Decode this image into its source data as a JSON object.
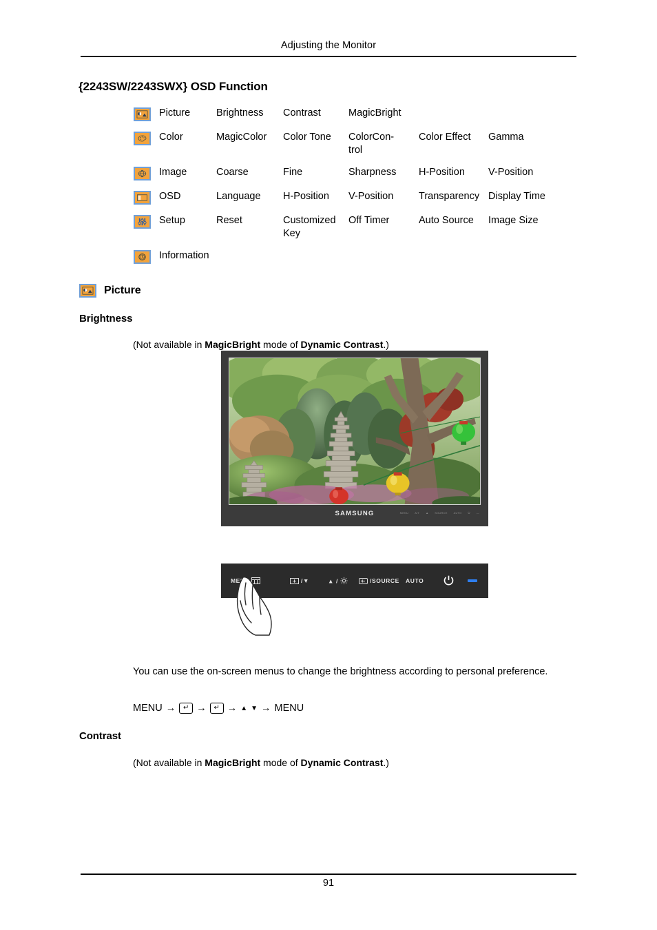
{
  "header": {
    "running_title": "Adjusting the Monitor"
  },
  "section": {
    "title": "{2243SW/2243SWX} OSD Function"
  },
  "osd_table": {
    "rows": [
      {
        "icon": "picture-icon",
        "category": "Picture",
        "items": [
          "Brightness",
          "Contrast",
          "MagicBright",
          "",
          ""
        ]
      },
      {
        "icon": "color-palette-icon",
        "category": "Color",
        "items": [
          "MagicColor",
          "Color Tone",
          "Color Con-trol",
          "Color Effect",
          "Gamma"
        ]
      },
      {
        "icon": "image-icon",
        "category": "Image",
        "items": [
          "Coarse",
          "Fine",
          "Sharpness",
          "H-Position",
          "V-Position"
        ]
      },
      {
        "icon": "osd-icon",
        "category": "OSD",
        "items": [
          "Language",
          "H-Position",
          "V-Position",
          "Transparency",
          "Display Time"
        ]
      },
      {
        "icon": "setup-sliders-icon",
        "category": "Setup",
        "items": [
          "Reset",
          "Customized Key",
          "Off Timer",
          "Auto Source",
          "Image Size"
        ]
      },
      {
        "icon": "information-clock-icon",
        "category": "Information",
        "items": [
          "",
          "",
          "",
          "",
          ""
        ]
      }
    ],
    "color_control_part1": "Color",
    "color_control_part2": "Con-",
    "color_control_part3": "trol"
  },
  "picture_section": {
    "heading": "Picture",
    "brightness": {
      "heading": "Brightness",
      "note_prefix": "(Not available in ",
      "note_bold1": "MagicBright",
      "note_middle": " mode of ",
      "note_bold2": "Dynamic Contrast",
      "note_suffix": ".)",
      "body": "You can use the on-screen menus to change the brightness according to personal preference.",
      "nav_start": "MENU",
      "nav_enter": "↵",
      "nav_arrow_up": "▲",
      "nav_arrow_down": "▼",
      "nav_end": "MENU",
      "nav_separator": "→"
    },
    "contrast": {
      "heading": "Contrast",
      "note_prefix": "(Not available in ",
      "note_bold1": "MagicBright",
      "note_middle": " mode of ",
      "note_bold2": "Dynamic Contrast",
      "note_suffix": ".)"
    }
  },
  "monitor_figure": {
    "brand": "SAMSUNG",
    "bezel_keys": [
      "MENU",
      "A/T",
      "▲",
      "SOURCE",
      "AUTO",
      "⏻",
      "—"
    ]
  },
  "control_panel": {
    "menu_label": "MENU",
    "down_label": "/▼",
    "up_label": "/",
    "source_label": "/SOURCE",
    "auto_label": "AUTO",
    "power_label": "power-button",
    "led_label": "power-led"
  },
  "footer": {
    "page_number": "91"
  },
  "colors": {
    "icon_fill": "#f2a33c",
    "icon_border": "#6f9fd8",
    "led_blue": "#2f7ff0",
    "bezel_dark": "#3b3b3b",
    "panel_dark": "#2b2b2b"
  }
}
